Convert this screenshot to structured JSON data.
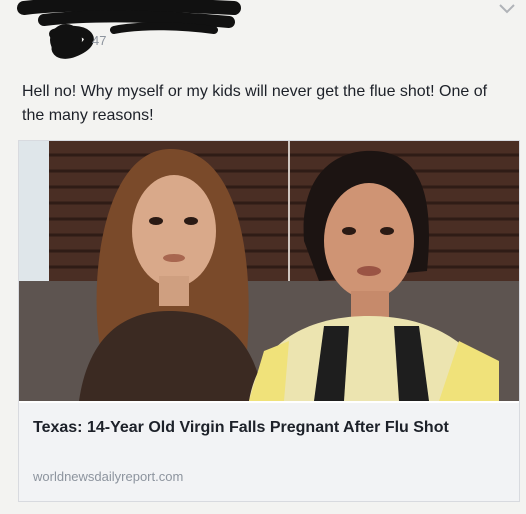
{
  "header": {
    "meta_text": "47",
    "menu_icon": "chevron-down-icon"
  },
  "post": {
    "text": "Hell no! Why myself or my kids will never get the flue shot! One of the many reasons!"
  },
  "link_preview": {
    "title": "Texas: 14-Year Old Virgin Falls Pregnant After Flu Shot",
    "domain": "worldnewsdailyreport.com"
  },
  "colors": {
    "background": "#f3f3f1",
    "card_footer": "#f2f3f5",
    "muted_text": "#8d949e"
  }
}
